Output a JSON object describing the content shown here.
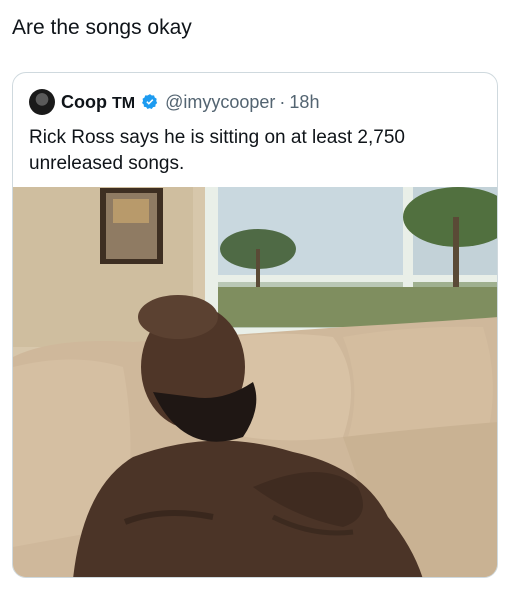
{
  "post": {
    "text": "Are the songs okay"
  },
  "quoted": {
    "name": "Coop",
    "name_suffix": "TM",
    "handle": "@imyycooper",
    "separator": "·",
    "time": "18h",
    "text": "Rick Ross says he is sitting on at least 2,750 unreleased songs.",
    "verified_color": "#1d9bf0",
    "media_icon": "photo-man-lounging-on-couch"
  }
}
